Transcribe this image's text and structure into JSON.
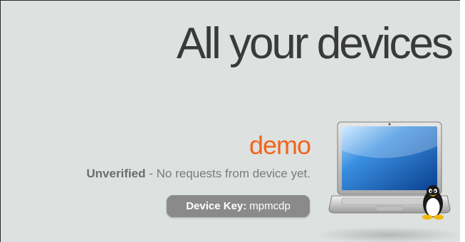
{
  "header": {
    "title": "All your devices"
  },
  "device": {
    "name": "demo",
    "status": "Unverified",
    "status_detail": " - No requests from device yet.",
    "key_label": "Device Key:",
    "key_value": "mpmcdp",
    "image_icon": "laptop-with-linux-penguin"
  },
  "colors": {
    "background": "#dde1df",
    "device_name": "#f0641e",
    "pill": "#8a8a8a"
  }
}
